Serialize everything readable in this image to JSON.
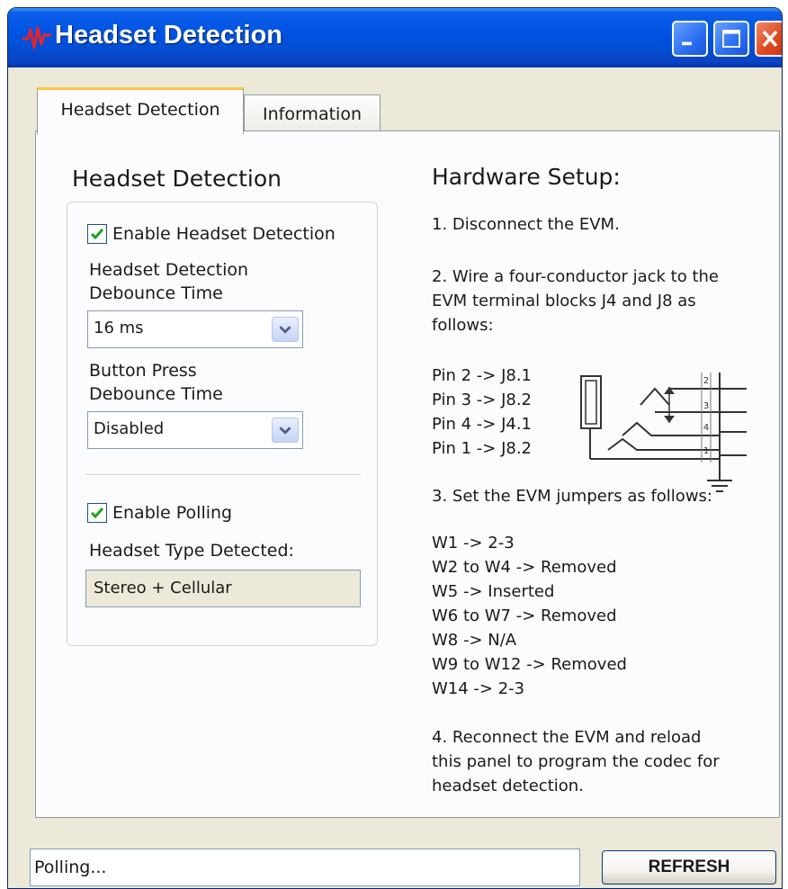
{
  "window": {
    "title": "Headset Detection"
  },
  "tabs": [
    {
      "label": "Headset Detection",
      "active": true
    },
    {
      "label": "Information",
      "active": false
    }
  ],
  "detection": {
    "section_title": "Headset Detection",
    "enable_detection_label": "Enable Headset Detection",
    "enable_detection_checked": true,
    "debounce_label_line1": "Headset Detection",
    "debounce_label_line2": "Debounce Time",
    "debounce_value": "16 ms",
    "button_label_line1": "Button Press",
    "button_label_line2": "Debounce Time",
    "button_value": "Disabled",
    "enable_polling_label": "Enable Polling",
    "enable_polling_checked": true,
    "type_detected_label": "Headset Type Detected:",
    "type_detected_value": "Stereo + Cellular"
  },
  "hardware": {
    "title": "Hardware Setup:",
    "step1": "1. Disconnect the EVM.",
    "step2_lines": [
      "2. Wire a four-conductor jack to the",
      "EVM terminal blocks J4 and J8 as",
      "follows:"
    ],
    "pins": [
      "Pin 2 -> J8.1",
      "Pin 3 -> J8.2",
      "Pin 4 -> J4.1",
      "Pin 1 -> J8.2"
    ],
    "jack_numbers": [
      "2",
      "3",
      "4",
      "1"
    ],
    "step3": "3. Set the EVM jumpers as follows:",
    "jumpers": [
      "W1 -> 2-3",
      "W2 to W4 -> Removed",
      "W5 -> Inserted",
      "W6 to W7 -> Removed",
      "W8 -> N/A",
      "W9 to W12 -> Removed",
      "W14 -> 2-3"
    ],
    "step4_lines": [
      "4. Reconnect the EVM and reload",
      "this panel to program the codec for",
      "headset detection."
    ]
  },
  "status": {
    "text": "Polling...",
    "refresh_label": "REFRESH"
  },
  "colors": {
    "titlebar": "#0054e3",
    "panel": "#ece9d8",
    "checkmark": "#21a121",
    "active_tab_accent": "#ffc83c"
  }
}
